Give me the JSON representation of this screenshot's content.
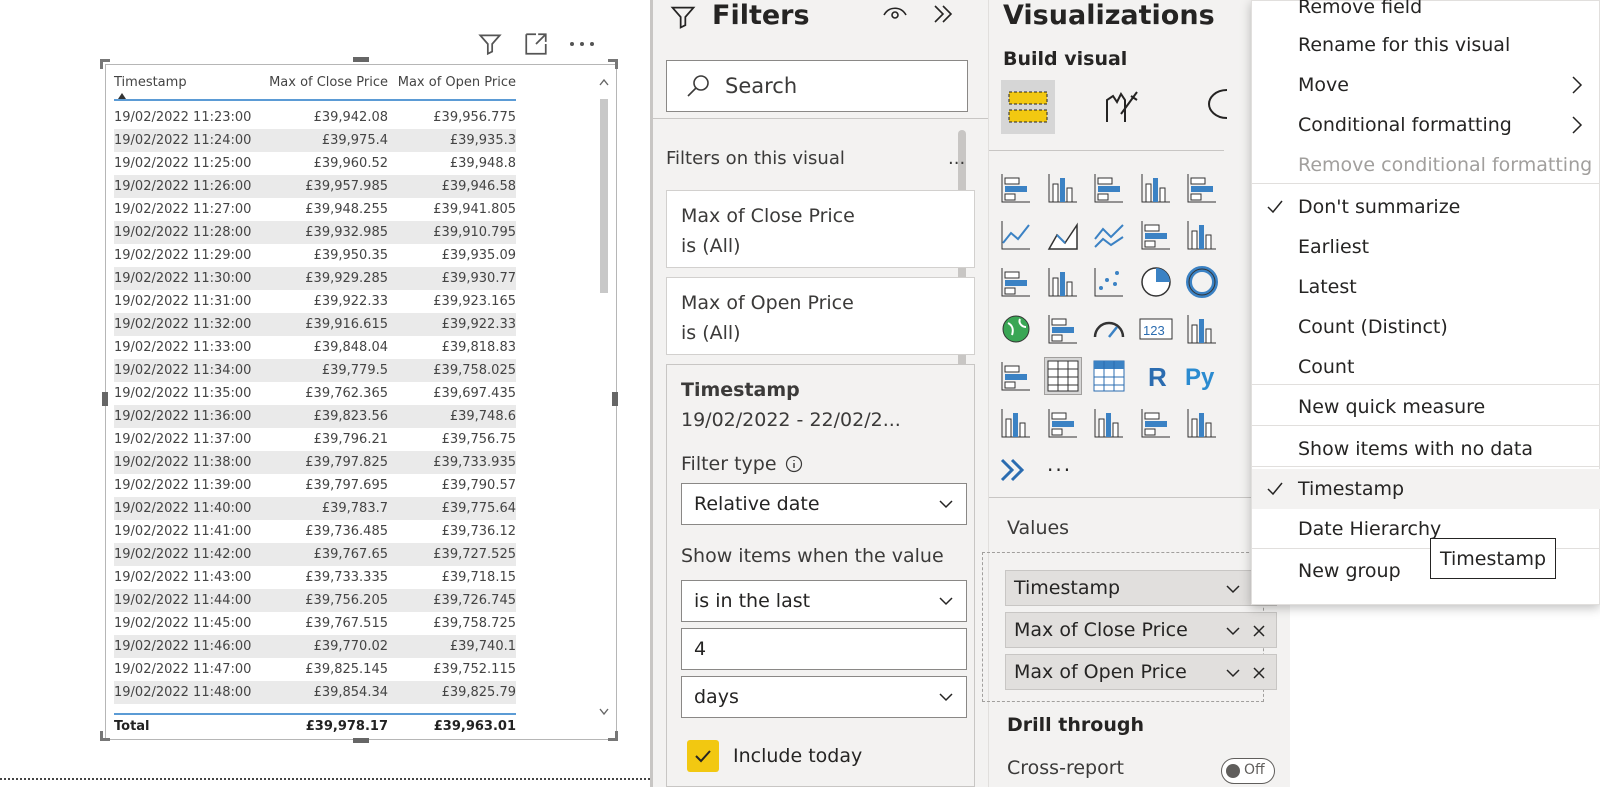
{
  "table": {
    "headers": [
      "Timestamp",
      "Max of Close Price",
      "Max of Open Price"
    ],
    "rows": [
      [
        "19/02/2022 11:23:00",
        "£39,942.08",
        "£39,956.775"
      ],
      [
        "19/02/2022 11:24:00",
        "£39,975.4",
        "£39,935.3"
      ],
      [
        "19/02/2022 11:25:00",
        "£39,960.52",
        "£39,948.8"
      ],
      [
        "19/02/2022 11:26:00",
        "£39,957.985",
        "£39,946.58"
      ],
      [
        "19/02/2022 11:27:00",
        "£39,948.255",
        "£39,941.805"
      ],
      [
        "19/02/2022 11:28:00",
        "£39,932.985",
        "£39,910.795"
      ],
      [
        "19/02/2022 11:29:00",
        "£39,950.35",
        "£39,935.09"
      ],
      [
        "19/02/2022 11:30:00",
        "£39,929.285",
        "£39,930.77"
      ],
      [
        "19/02/2022 11:31:00",
        "£39,922.33",
        "£39,923.165"
      ],
      [
        "19/02/2022 11:32:00",
        "£39,916.615",
        "£39,922.33"
      ],
      [
        "19/02/2022 11:33:00",
        "£39,848.04",
        "£39,818.83"
      ],
      [
        "19/02/2022 11:34:00",
        "£39,779.5",
        "£39,758.025"
      ],
      [
        "19/02/2022 11:35:00",
        "£39,762.365",
        "£39,697.435"
      ],
      [
        "19/02/2022 11:36:00",
        "£39,823.56",
        "£39,748.6"
      ],
      [
        "19/02/2022 11:37:00",
        "£39,796.21",
        "£39,756.75"
      ],
      [
        "19/02/2022 11:38:00",
        "£39,797.825",
        "£39,733.935"
      ],
      [
        "19/02/2022 11:39:00",
        "£39,797.695",
        "£39,790.57"
      ],
      [
        "19/02/2022 11:40:00",
        "£39,783.7",
        "£39,775.64"
      ],
      [
        "19/02/2022 11:41:00",
        "£39,736.485",
        "£39,736.12"
      ],
      [
        "19/02/2022 11:42:00",
        "£39,767.65",
        "£39,727.525"
      ],
      [
        "19/02/2022 11:43:00",
        "£39,733.335",
        "£39,718.15"
      ],
      [
        "19/02/2022 11:44:00",
        "£39,756.205",
        "£39,726.745"
      ],
      [
        "19/02/2022 11:45:00",
        "£39,767.515",
        "£39,758.725"
      ],
      [
        "19/02/2022 11:46:00",
        "£39,770.02",
        "£39,740.1"
      ],
      [
        "19/02/2022 11:47:00",
        "£39,825.145",
        "£39,752.115"
      ],
      [
        "19/02/2022 11:48:00",
        "£39,854.34",
        "£39,825.79"
      ],
      [
        "19/02/2022 11:49:00",
        "£39,818.87",
        "£39,801.705"
      ]
    ],
    "total": [
      "Total",
      "£39,978.17",
      "£39,963.01"
    ]
  },
  "filters": {
    "title": "Filters",
    "search_placeholder": "Search",
    "section_label": "Filters on this visual",
    "section_more": "...",
    "cards": [
      {
        "title": "Max of Close Price",
        "value": "is (All)"
      },
      {
        "title": "Max of Open Price",
        "value": "is (All)"
      }
    ],
    "timestamp": {
      "title": "Timestamp",
      "range": "19/02/2022 - 22/02/2...",
      "filter_type_label": "Filter type",
      "filter_type_value": "Relative date",
      "show_items_label": "Show items when the value",
      "condition_value": "is in the last",
      "count_value": "4",
      "unit_value": "days",
      "include_today_label": "Include today",
      "include_today_checked": true
    }
  },
  "visualizations": {
    "title": "Visualizations",
    "build_visual_label": "Build visual",
    "more_visuals": "...",
    "values_label": "Values",
    "wells": [
      "Timestamp",
      "Max of Close Price",
      "Max of Open Price"
    ],
    "drill_through_label": "Drill through",
    "cross_report_label": "Cross-report",
    "toggle_text": "Off"
  },
  "context_menu": {
    "items": [
      {
        "label": "Remove field",
        "state": "normal"
      },
      {
        "label": "Rename for this visual",
        "state": "normal"
      },
      {
        "label": "Move",
        "state": "submenu"
      },
      {
        "label": "Conditional formatting",
        "state": "submenu"
      },
      {
        "label": "Remove conditional formatting",
        "state": "disabled"
      },
      {
        "label": "Don't summarize",
        "state": "checked"
      },
      {
        "label": "Earliest",
        "state": "normal"
      },
      {
        "label": "Latest",
        "state": "normal"
      },
      {
        "label": "Count (Distinct)",
        "state": "normal"
      },
      {
        "label": "Count",
        "state": "normal"
      },
      {
        "label": "New quick measure",
        "state": "normal"
      },
      {
        "label": "Show items with no data",
        "state": "normal"
      },
      {
        "label": "Timestamp",
        "state": "checked-selected"
      },
      {
        "label": "Date Hierarchy",
        "state": "normal"
      },
      {
        "label": "New group",
        "state": "normal"
      }
    ]
  },
  "tooltip": {
    "text": "Timestamp"
  },
  "colors": {
    "accent_yellow": "#f2c811",
    "table_header_line": "#5b9bd5",
    "pane_background": "#f3f2f1"
  }
}
